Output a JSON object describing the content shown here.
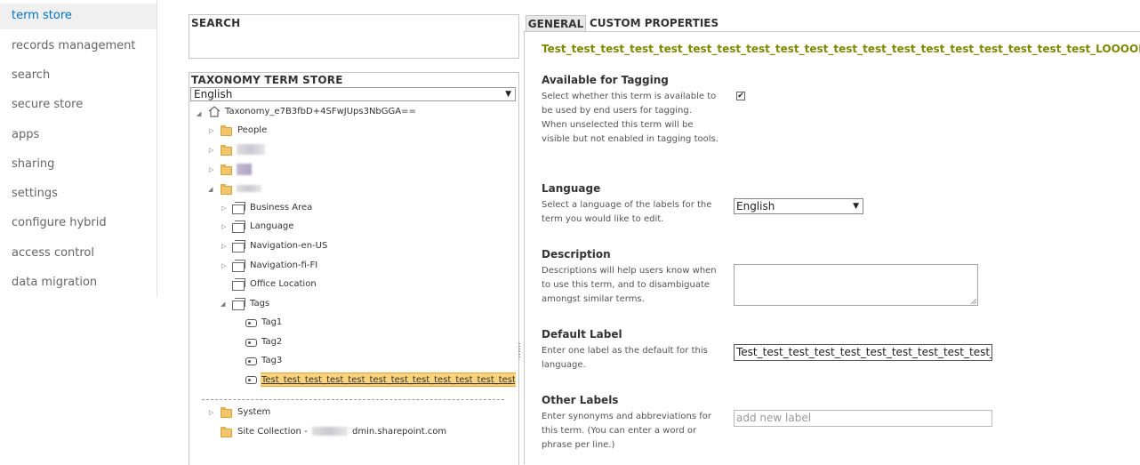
{
  "nav": {
    "items": [
      {
        "label": "term store",
        "active": true
      },
      {
        "label": "records management"
      },
      {
        "label": "search"
      },
      {
        "label": "secure store"
      },
      {
        "label": "apps"
      },
      {
        "label": "sharing"
      },
      {
        "label": "settings"
      },
      {
        "label": "configure hybrid"
      },
      {
        "label": "access control"
      },
      {
        "label": "data migration"
      }
    ]
  },
  "search_panel": {
    "title": "SEARCH"
  },
  "tree_panel": {
    "title": "TAXONOMY TERM STORE",
    "language": "English",
    "root": "Taxonomy_e7B3fbD+4SFwJUps3NbGGA==",
    "groups": {
      "people": "People"
    },
    "term_sets": [
      "Business Area",
      "Language",
      "Navigation-en-US",
      "Navigation-fi-FI",
      "Office Location",
      "Tags"
    ],
    "tags": [
      "Tag1",
      "Tag2",
      "Tag3"
    ],
    "selected_term": "Test_test_test_test_test_test_test_test_test_test_test_test_test_te",
    "system": "System",
    "site_collection_prefix": "Site Collection -",
    "site_collection_suffix": "dmin.sharepoint.com"
  },
  "tabs": {
    "general": "GENERAL",
    "custom": "CUSTOM PROPERTIES"
  },
  "term": {
    "title": "Test_test_test_test_test_test_test_test_test_test_test_test_test_test_test_test_test_test_test_LOOOONGBOI!",
    "tagging": {
      "heading": "Available for Tagging",
      "desc": "Select whether this term is available to be used by end users for tagging. When unselected this term will be visible but not enabled in tagging tools.",
      "checked": "✔"
    },
    "language": {
      "heading": "Language",
      "desc": "Select a language of the labels for the term you would like to edit.",
      "value": "English"
    },
    "description": {
      "heading": "Description",
      "desc": "Descriptions will help users know when to use this term, and to disambiguate amongst similar terms."
    },
    "default_label": {
      "heading": "Default Label",
      "desc": "Enter one label as the default for this language.",
      "value": "Test_test_test_test_test_test_test_test_test_test_test_test_"
    },
    "other_labels": {
      "heading": "Other Labels",
      "desc": "Enter synonyms and abbreviations for this term. (You can enter a word or phrase per line.)",
      "placeholder": "add new label"
    }
  }
}
